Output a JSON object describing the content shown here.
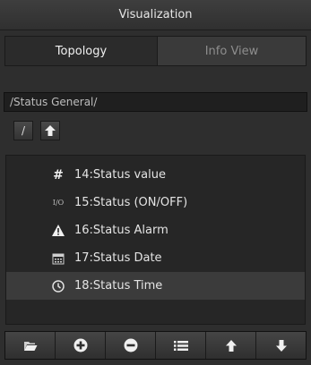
{
  "window": {
    "title": "Visualization"
  },
  "tabs": [
    {
      "label": "Topology",
      "active": true
    },
    {
      "label": "Info View",
      "active": false
    }
  ],
  "path": {
    "value": "/Status General/"
  },
  "nav": {
    "root_label": "/"
  },
  "items": [
    {
      "label": "14:Status value",
      "icon": "hash-icon",
      "glyph": "#"
    },
    {
      "label": "15:Status (ON/OFF)",
      "icon": "io-icon",
      "glyph": "I/O"
    },
    {
      "label": "16:Status Alarm",
      "icon": "warning-icon"
    },
    {
      "label": "17:Status Date",
      "icon": "calendar-icon"
    },
    {
      "label": "18:Status Time",
      "icon": "clock-icon",
      "selected": true
    }
  ],
  "toolbar": [
    "open-folder-icon",
    "add-icon",
    "remove-icon",
    "list-icon",
    "arrow-up-icon",
    "arrow-down-icon"
  ],
  "colors": {
    "background": "#2e2e2e",
    "selected_row": "#3b3b3b",
    "text": "#e4e4e4"
  }
}
